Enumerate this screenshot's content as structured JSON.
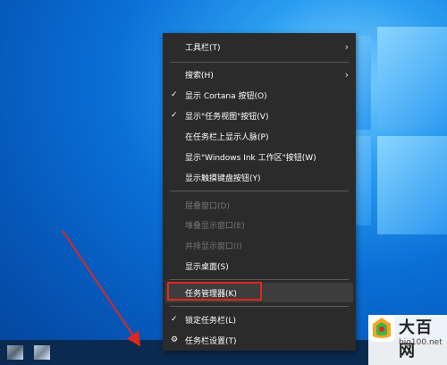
{
  "context_menu": {
    "items": [
      {
        "label": "工具栏(T)",
        "checked": false,
        "disabled": false,
        "submenu": true
      },
      {
        "label": "搜索(H)",
        "checked": false,
        "disabled": false,
        "submenu": true
      },
      {
        "label": "显示 Cortana 按钮(O)",
        "checked": true,
        "disabled": false,
        "submenu": false
      },
      {
        "label": "显示\"任务视图\"按钮(V)",
        "checked": true,
        "disabled": false,
        "submenu": false
      },
      {
        "label": "在任务栏上显示人脉(P)",
        "checked": false,
        "disabled": false,
        "submenu": false
      },
      {
        "label": "显示\"Windows Ink 工作区\"按钮(W)",
        "checked": false,
        "disabled": false,
        "submenu": false
      },
      {
        "label": "显示触摸键盘按钮(Y)",
        "checked": false,
        "disabled": false,
        "submenu": false
      },
      {
        "label": "层叠窗口(D)",
        "checked": false,
        "disabled": true,
        "submenu": false
      },
      {
        "label": "堆叠显示窗口(E)",
        "checked": false,
        "disabled": true,
        "submenu": false
      },
      {
        "label": "并排显示窗口(I)",
        "checked": false,
        "disabled": true,
        "submenu": false
      },
      {
        "label": "显示桌面(S)",
        "checked": false,
        "disabled": false,
        "submenu": false
      },
      {
        "label": "任务管理器(K)",
        "checked": false,
        "disabled": false,
        "submenu": false,
        "highlighted": true
      },
      {
        "label": "锁定任务栏(L)",
        "checked": true,
        "disabled": false,
        "submenu": false
      },
      {
        "label": "任务栏设置(T)",
        "checked": false,
        "disabled": false,
        "submenu": false,
        "icon": "gear-icon"
      }
    ]
  },
  "glyphs": {
    "check": "✓",
    "arrow": "›",
    "gear": "⚙"
  },
  "taskbar": {
    "icons": [
      "app-icon",
      "app-icon"
    ]
  },
  "watermark": {
    "title": "大百网",
    "url": "big100.net"
  },
  "colors": {
    "menu_bg": "#2b2b2b",
    "annotation_red": "#e0281e",
    "desktop_blue": "#0a6fd6"
  }
}
